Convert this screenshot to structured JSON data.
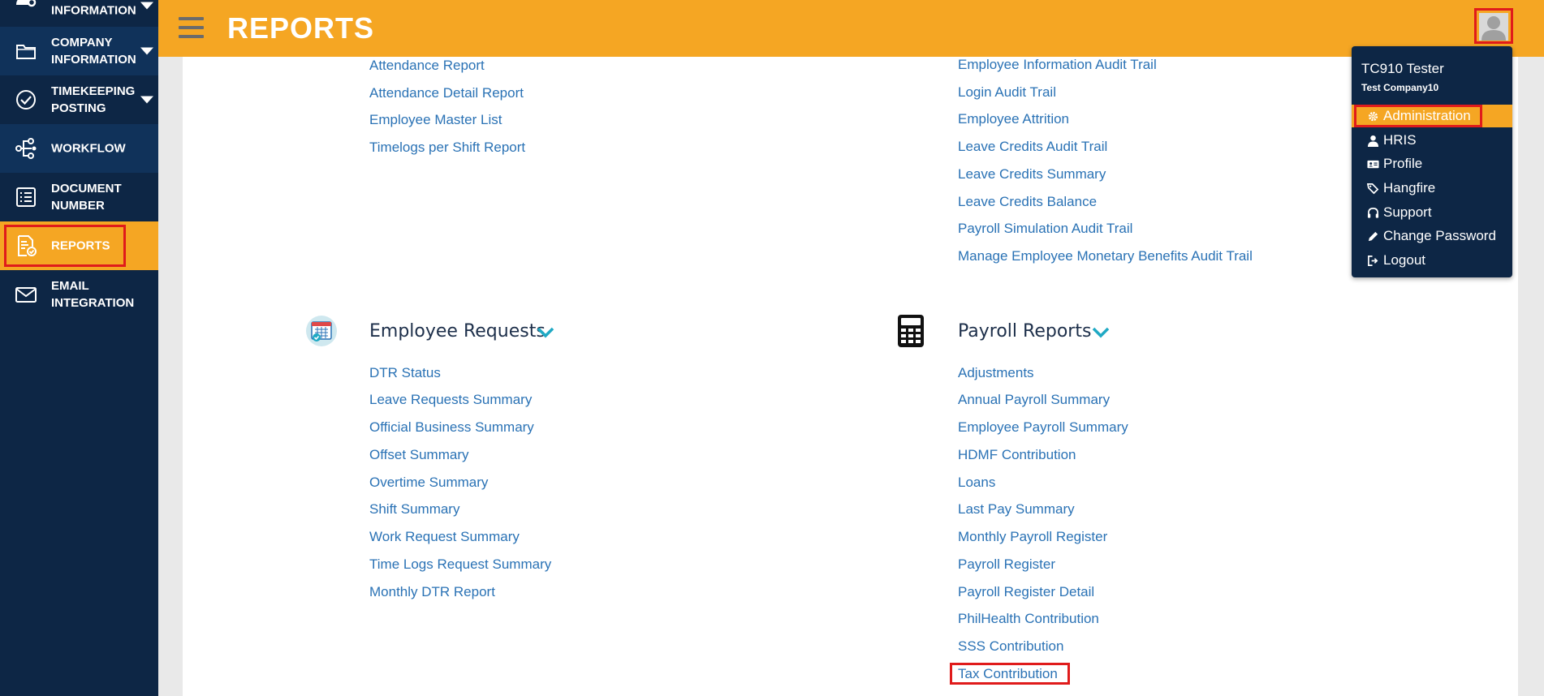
{
  "sidebar": {
    "items": [
      {
        "label": "INFORMATION",
        "icon": "user-gear-icon",
        "has_caret": true
      },
      {
        "label": "COMPANY INFORMATION",
        "icon": "folder-icon",
        "has_caret": true
      },
      {
        "label": "TIMEKEEPING POSTING",
        "icon": "check-circle-icon",
        "has_caret": true
      },
      {
        "label": "WORKFLOW",
        "icon": "workflow-icon",
        "has_caret": false
      },
      {
        "label": "DOCUMENT NUMBER",
        "icon": "list-icon",
        "has_caret": false
      },
      {
        "label": "REPORTS",
        "icon": "report-icon",
        "has_caret": false,
        "active": true
      },
      {
        "label": "EMAIL INTEGRATION",
        "icon": "envelope-icon",
        "has_caret": false
      }
    ]
  },
  "header": {
    "title": "REPORTS",
    "menu_icon": "hamburger-icon",
    "avatar_icon": "user-avatar-icon"
  },
  "reports": {
    "top_left_links": [
      "Attendance Report",
      "Attendance Detail Report",
      "Employee Master List",
      "Timelogs per Shift Report"
    ],
    "top_right_links": [
      "Employee Information Audit Trail",
      "Login Audit Trail",
      "Employee Attrition",
      "Leave Credits Audit Trail",
      "Leave Credits Summary",
      "Leave Credits Balance",
      "Payroll Simulation Audit Trail",
      "Manage Employee Monetary Benefits Audit Trail"
    ],
    "employee_requests": {
      "title": "Employee Requests",
      "icon": "calendar-check-icon",
      "links": [
        "DTR Status",
        "Leave Requests Summary",
        "Official Business Summary",
        "Offset Summary",
        "Overtime Summary",
        "Shift Summary",
        "Work Request Summary",
        "Time Logs Request Summary",
        "Monthly DTR Report"
      ]
    },
    "payroll_reports": {
      "title": "Payroll Reports",
      "icon": "calculator-icon",
      "links": [
        "Adjustments",
        "Annual Payroll Summary",
        "Employee Payroll Summary",
        "HDMF Contribution",
        "Loans",
        "Last Pay Summary",
        "Monthly Payroll Register",
        "Payroll Register",
        "Payroll Register Detail",
        "PhilHealth Contribution",
        "SSS Contribution",
        "Tax Contribution"
      ]
    }
  },
  "user_menu": {
    "name": "TC910 Tester",
    "company": "Test Company10",
    "items": [
      {
        "label": "Administration",
        "icon": "gear-icon",
        "active": true
      },
      {
        "label": "HRIS",
        "icon": "user-icon"
      },
      {
        "label": "Profile",
        "icon": "id-card-icon"
      },
      {
        "label": "Hangfire",
        "icon": "tags-icon"
      },
      {
        "label": "Support",
        "icon": "headset-icon"
      },
      {
        "label": "Change Password",
        "icon": "pencil-icon"
      },
      {
        "label": "Logout",
        "icon": "sign-out-icon"
      }
    ]
  },
  "colors": {
    "accent": "#f5a623",
    "sidebar": "#0d2645",
    "link": "#2a72b5",
    "highlight": "#e01b1b",
    "chevron": "#1fa9c4"
  }
}
